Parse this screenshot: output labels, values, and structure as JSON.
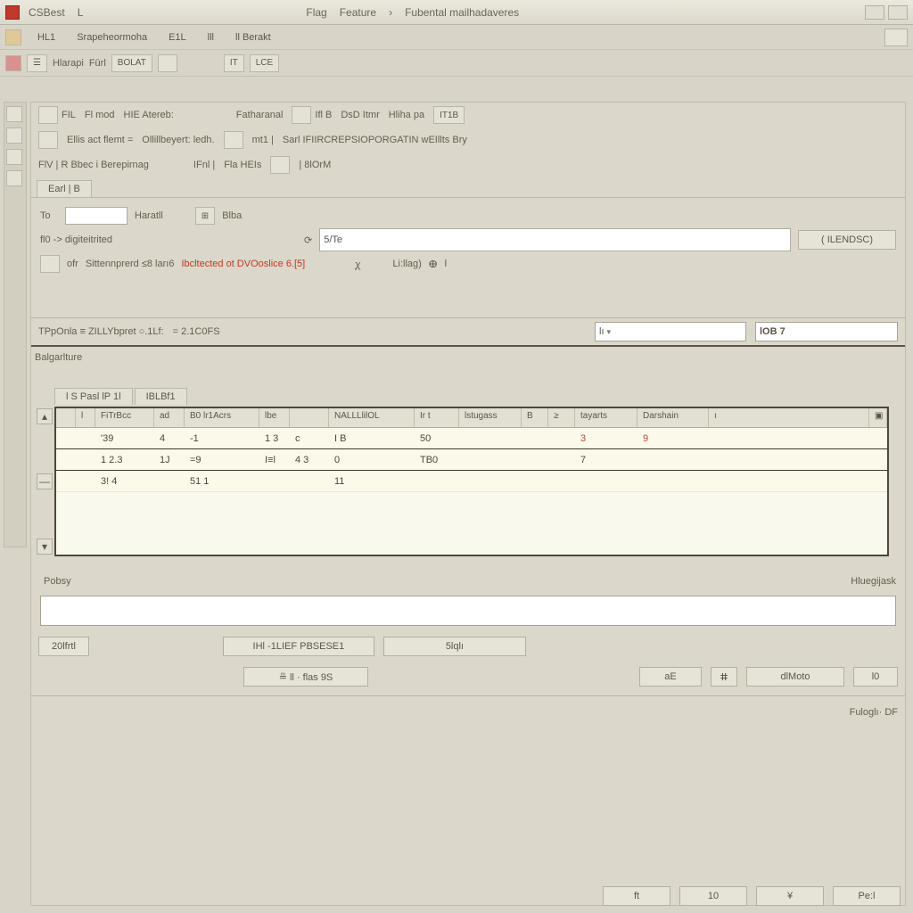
{
  "title": {
    "app": "CSBest",
    "menu1": "L",
    "menu2": "Flag",
    "menu3": "Feature",
    "menu4": "Fubental mailhadaveres"
  },
  "menu": {
    "i1": "HL1",
    "i2": "Srapeheormoha",
    "i3": "E1L",
    "i4": "lll",
    "i5": "ll Berakt"
  },
  "tb2": {
    "i1": "Hlarapi",
    "i2": "Fūrl",
    "i3": "BOLAT",
    "sp": "|",
    "g2a": "IT",
    "g2b": "LCE"
  },
  "r1": {
    "a": "FIL",
    "b": "Fl mod",
    "c": "HIE Atereb:",
    "d": "Fatharanal",
    "e": "Ifl B",
    "f": "DsD Itmr",
    "g": "Hliha pa",
    "h": "IT1B"
  },
  "r2": {
    "a": "Ellis act flemt =",
    "b": "Ollillbeyert: ledh.",
    "c": "mt1 |",
    "d": "Sarl IFIIRCREPSIOPORGATIN wEIllts Bry"
  },
  "r3": {
    "a": "FlV | R Bbec i Berepirnag",
    "b": "IFnl |",
    "c": "Fla HEIs",
    "d": "|  8lOrM"
  },
  "tabs": {
    "t1": "Earl | B"
  },
  "f1": {
    "a": "To",
    "b": "Haratll",
    "c": "Blba"
  },
  "search": {
    "value": "5/Te",
    "btn": "( ILENDSC)"
  },
  "f2": {
    "lbl": "fl0 -> digiteitrited",
    "icon": "⟳"
  },
  "bar": {
    "a": "ofr",
    "b": "Sittennprerd  ≤8 ları6",
    "c": "Ibcltected ot DVOoslice 6.[5]",
    "d": "ꭕ",
    "e": "Li:llag)",
    "f": "ⴲ",
    "g": "l"
  },
  "sect2": {
    "lbl": "TPpOnla ≡ ZILLYbpret ○.1Lf:",
    "eq": "= 2.1C0FS",
    "sel1": "lı",
    "selbtn": "▾",
    "sel2": "lOB  7"
  },
  "detail_label": "Balgarlture",
  "grid": {
    "tabs": {
      "t1": "l S Pasl lP 1l",
      "t2": "IBLBf1"
    },
    "cols": [
      "",
      "l",
      "FiTrBcc",
      "ad",
      "B0 lr1Acrs",
      "lbe",
      "",
      "NALLLlilOL",
      "Ir  t",
      "lstugass",
      "B",
      "≥",
      "tayarts",
      "Darshain",
      "ı"
    ],
    "rows": [
      [
        "",
        "",
        "'39",
        "4",
        "-1",
        "1 3",
        "c",
        "I B",
        "50",
        "",
        "",
        "",
        "3",
        "9",
        ""
      ],
      [
        "",
        "",
        "1 2.3",
        "1J",
        "=9",
        "I≡l",
        "4  3",
        "0",
        "TB0",
        "",
        "",
        "",
        "7",
        "",
        ""
      ],
      [
        "",
        "",
        "3! 4",
        "",
        "51 1",
        "",
        "",
        "11",
        "",
        "",
        "",
        "",
        "",
        "",
        ""
      ]
    ]
  },
  "notes": {
    "lbl": "Pobsy",
    "right": "Hluegijask"
  },
  "btns": {
    "b1": "20lfrtl",
    "b2": "IHl -1LIEF PBSESE1",
    "b3": "5lqlı",
    "b4": "≞ ll · flas 9S",
    "b5": "aE",
    "b6": "ⵌ",
    "b7": "dlMoto",
    "b8": "l0"
  },
  "footer": {
    "lbl": "Fuloglı·   DF",
    "f1": "ft",
    "f2": "10",
    "f3": "¥",
    "f4": "Pe:l"
  }
}
